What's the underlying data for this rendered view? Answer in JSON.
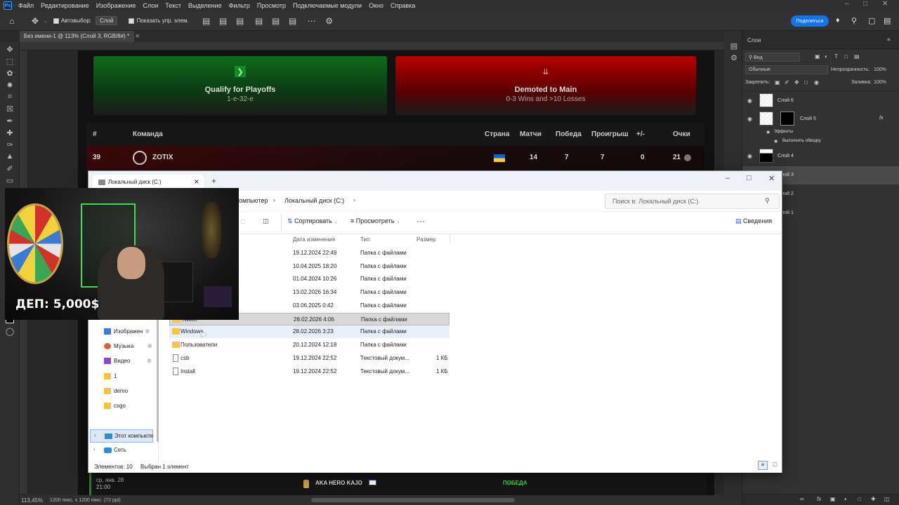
{
  "ps_menu": {
    "logo": "Ps",
    "items": [
      "Файл",
      "Редактирование",
      "Изображение",
      "Слои",
      "Текст",
      "Выделение",
      "Фильтр",
      "Просмотр",
      "Подключаемые модули",
      "Окно",
      "Справка"
    ]
  },
  "ps_options": {
    "autoselect_label": "Автовыбор:",
    "autoselect_value": "Слой",
    "show_controls_label": "Показать упр. элем.",
    "share_label": "Поделиться"
  },
  "ps_doc_tab": {
    "title": "Без имени-1 @ 113% (Слой 3, RGB/8#) *"
  },
  "ps_status": {
    "zoom": "113,45%",
    "info": "1200 пикс. x 1200 пикс. (72 ppi)"
  },
  "document": {
    "card_qualify": {
      "title": "Qualify for Playoffs",
      "subtitle": "1-е-32-е"
    },
    "card_demoted": {
      "title": "Demoted to Main",
      "subtitle": "0-3 Wins and >10 Losses"
    },
    "table_headers": {
      "rank": "#",
      "team": "Команда",
      "country": "Страна",
      "matches": "Матчи",
      "wins": "Победа",
      "losses": "Проигрыш",
      "diff": "+/-",
      "points": "Очки"
    },
    "row": {
      "rank": "39",
      "team": "ZOTIX",
      "matches": "14",
      "wins": "7",
      "losses": "7",
      "diff": "0",
      "points": "21"
    },
    "bottom": {
      "date": "ср, янв. 28",
      "time": "21:00",
      "opponent": "AKA HERO KAJO",
      "result": "ПОБЕДА"
    }
  },
  "layers": {
    "tab_label": "Слои",
    "filter_label": "Вид",
    "blend_mode": "Обычные",
    "opacity_label": "Непрозрачность:",
    "opacity_value": "100%",
    "lock_label": "Закрепить:",
    "fill_label": "Заливка:",
    "fill_value": "100%",
    "items": [
      {
        "name": "Слой 6"
      },
      {
        "name": "Слой 5"
      },
      {
        "name": "Эффекты"
      },
      {
        "name": "Выполнить обводку"
      },
      {
        "name": "Слой 4"
      },
      {
        "name": "Слой 3"
      },
      {
        "name": "Слой 2"
      },
      {
        "name": "Слой 1"
      }
    ]
  },
  "explorer": {
    "tab_title": "Локальный диск (C:)",
    "breadcrumb": [
      "компьютер",
      "Локальный диск (C:)"
    ],
    "search_placeholder": "Поиск в: Локальный диск (C:)",
    "commands": {
      "sort": "Сортировать",
      "view": "Просмотреть",
      "more": "···",
      "details": "Сведения"
    },
    "columns": {
      "modified": "Дата изменения",
      "type": "Тип",
      "size": "Размер"
    },
    "rows": [
      {
        "name": "",
        "modified": "19.12.2024 22:49",
        "type": "Папка с файлами",
        "size": "",
        "kind": "folder"
      },
      {
        "name": "",
        "modified": "10.04.2025 18:20",
        "type": "Папка с файлами",
        "size": "",
        "kind": "folder"
      },
      {
        "name": "",
        "modified": "01.04.2024 10:26",
        "type": "Папка с файлами",
        "size": "",
        "kind": "folder"
      },
      {
        "name": "",
        "modified": "13.02.2026 16:34",
        "type": "Папка с файлами",
        "size": "",
        "kind": "folder"
      },
      {
        "name": "",
        "modified": "03.06.2025 0:42",
        "type": "Папка с файлами",
        "size": "",
        "kind": "folder"
      },
      {
        "name": "Twitch",
        "modified": "28.02.2026 4:06",
        "type": "Папка с файлами",
        "size": "",
        "kind": "folder"
      },
      {
        "name": "Windows",
        "modified": "28.02.2026 3:23",
        "type": "Папка с файлами",
        "size": "",
        "kind": "folder"
      },
      {
        "name": "Пользователи",
        "modified": "20.12.2024 12:18",
        "type": "Папка с файлами",
        "size": "",
        "kind": "folder"
      },
      {
        "name": "csb",
        "modified": "19.12.2024 22:52",
        "type": "Текстовый докум...",
        "size": "1 КБ",
        "kind": "file"
      },
      {
        "name": "Install",
        "modified": "19.12.2024 22:52",
        "type": "Текстовый докум...",
        "size": "1 КБ",
        "kind": "file"
      }
    ],
    "nav": {
      "images": "Изображен",
      "music": "Музыка",
      "video": "Видео",
      "folder1": "1",
      "demo": "demo",
      "csgo": "csgo",
      "this_pc": "Этот компьюте",
      "network": "Сеть"
    },
    "status": {
      "count": "Элементов: 10",
      "selected": "Выбран 1 элемент"
    }
  },
  "webcam": {
    "deposit_text": "ДЕП: 5,000$"
  }
}
